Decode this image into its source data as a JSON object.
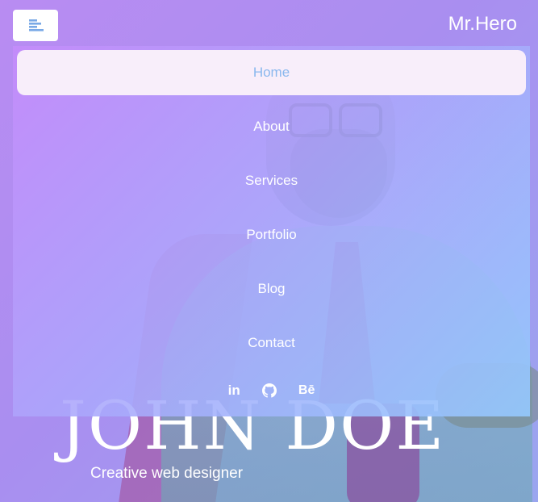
{
  "header": {
    "brand": "Mr.Hero",
    "menu_toggle_icon": "align-left-icon"
  },
  "menu": {
    "items": [
      {
        "label": "Home",
        "active": true
      },
      {
        "label": "About",
        "active": false
      },
      {
        "label": "Services",
        "active": false
      },
      {
        "label": "Portfolio",
        "active": false
      },
      {
        "label": "Blog",
        "active": false
      },
      {
        "label": "Contact",
        "active": false
      }
    ],
    "socials": [
      {
        "icon": "linkedin-icon",
        "label": "in"
      },
      {
        "icon": "github-icon",
        "label": ""
      },
      {
        "icon": "behance-icon",
        "label": "Bē"
      }
    ]
  },
  "hero": {
    "name": "JOHN DOE",
    "subtitle": "Creative web designer"
  },
  "colors": {
    "active_item_bg": "#f8eefa",
    "active_item_text": "#8ab8ee",
    "menu_gradient_start": "#c48cfa",
    "menu_gradient_end": "#94c8fc"
  }
}
